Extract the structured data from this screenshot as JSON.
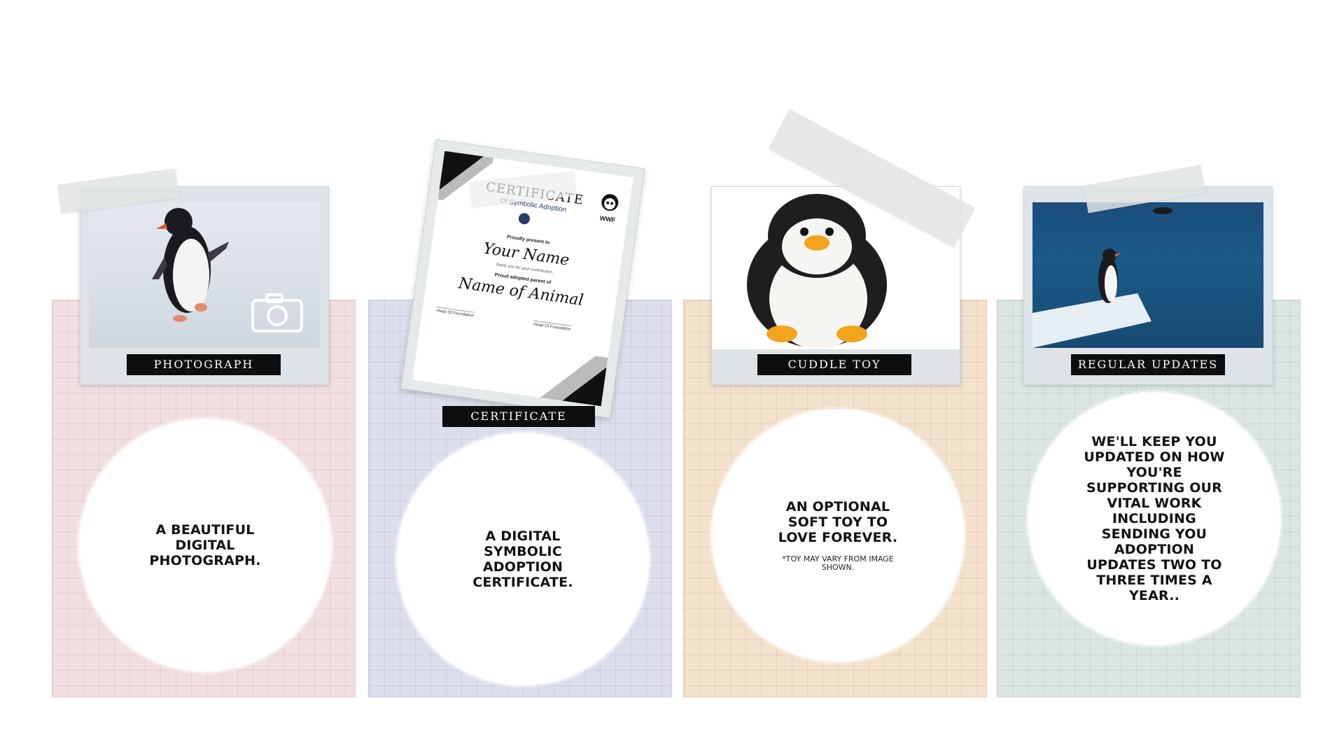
{
  "cards": [
    {
      "label": "PHOTOGRAPH",
      "text": "A BEAUTIFUL DIGITAL PHOTOGRAPH.",
      "color": "#f1dfe0"
    },
    {
      "label": "CERTIFICATE",
      "text": "A DIGITAL SYMBOLIC ADOPTION CERTIFICATE.",
      "color": "#dcdeeb"
    },
    {
      "label": "CUDDLE TOY",
      "text": "AN OPTIONAL SOFT TOY TO LOVE FOREVER.",
      "note": "*TOY MAY VARY FROM IMAGE SHOWN.",
      "color": "#f3e1cc"
    },
    {
      "label": "REGULAR UPDATES",
      "text": "WE'LL KEEP YOU UPDATED ON HOW YOU'RE SUPPORTING OUR VITAL WORK INCLUDING SENDING YOU ADOPTION UPDATES TWO TO THREE TIMES A YEAR..",
      "color": "#dbe6e3"
    }
  ],
  "certificate": {
    "title": "CERTIFICATE",
    "subtitle": "Of Symbolic Adoption",
    "presented": "Proudly present to",
    "name": "Your Name",
    "thanks": "thank you for your contribution",
    "parent": "Proud adopted parent of",
    "animal": "Name of Animal",
    "sig1": "Head Of Foundation",
    "sig2": "Head Of Foundation",
    "logo_text": "WWF"
  },
  "icons": {
    "camera": "camera-icon"
  }
}
